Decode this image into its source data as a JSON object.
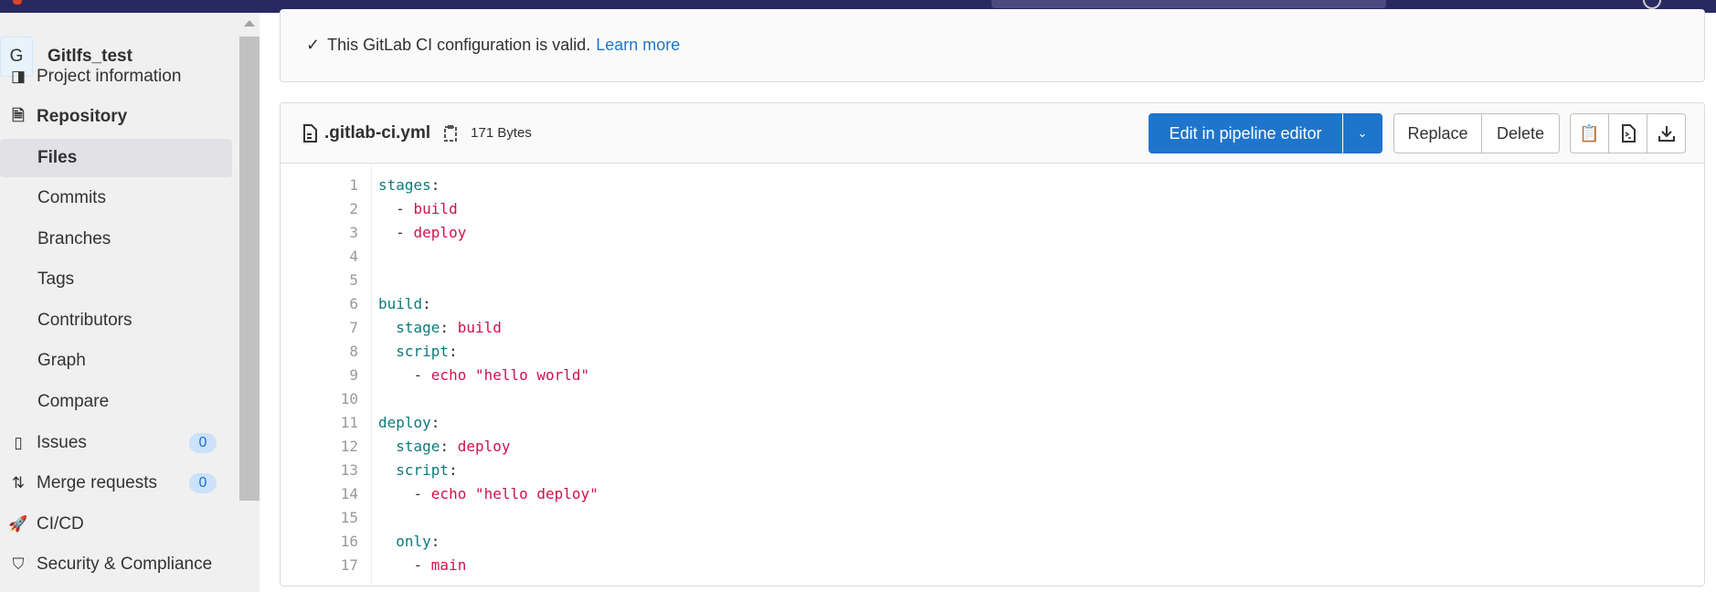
{
  "project": {
    "initial": "G",
    "name": "Gitlfs_test"
  },
  "sidebar": {
    "items": [
      {
        "label": "Project information",
        "icon": "project-info-icon"
      },
      {
        "label": "Repository",
        "icon": "document-icon"
      },
      {
        "label": "Files"
      },
      {
        "label": "Commits"
      },
      {
        "label": "Branches"
      },
      {
        "label": "Tags"
      },
      {
        "label": "Contributors"
      },
      {
        "label": "Graph"
      },
      {
        "label": "Compare"
      },
      {
        "label": "Issues",
        "icon": "issues-icon",
        "badge": "0"
      },
      {
        "label": "Merge requests",
        "icon": "merge-request-icon",
        "badge": "0"
      },
      {
        "label": "CI/CD",
        "icon": "rocket-icon"
      },
      {
        "label": "Security & Compliance",
        "icon": "shield-icon"
      }
    ]
  },
  "alert": {
    "text": "This GitLab CI configuration is valid.",
    "link": "Learn more"
  },
  "file": {
    "name": ".gitlab-ci.yml",
    "size": "171 Bytes",
    "edit_label": "Edit in pipeline editor",
    "replace_label": "Replace",
    "delete_label": "Delete",
    "lines": [
      [
        [
          "k",
          "stages"
        ],
        [
          "p",
          ":"
        ]
      ],
      [
        [
          "p",
          "  - "
        ],
        [
          "v",
          "build"
        ]
      ],
      [
        [
          "p",
          "  - "
        ],
        [
          "v",
          "deploy"
        ]
      ],
      [],
      [],
      [
        [
          "k",
          "build"
        ],
        [
          "p",
          ":"
        ]
      ],
      [
        [
          "p",
          "  "
        ],
        [
          "k",
          "stage"
        ],
        [
          "p",
          ": "
        ],
        [
          "v",
          "build"
        ]
      ],
      [
        [
          "p",
          "  "
        ],
        [
          "k",
          "script"
        ],
        [
          "p",
          ":"
        ]
      ],
      [
        [
          "p",
          "    - "
        ],
        [
          "v",
          "echo \"hello world\""
        ]
      ],
      [],
      [
        [
          "k",
          "deploy"
        ],
        [
          "p",
          ":"
        ]
      ],
      [
        [
          "p",
          "  "
        ],
        [
          "k",
          "stage"
        ],
        [
          "p",
          ": "
        ],
        [
          "v",
          "deploy"
        ]
      ],
      [
        [
          "p",
          "  "
        ],
        [
          "k",
          "script"
        ],
        [
          "p",
          ":"
        ]
      ],
      [
        [
          "p",
          "    - "
        ],
        [
          "v",
          "echo \"hello deploy\""
        ]
      ],
      [],
      [
        [
          "p",
          "  "
        ],
        [
          "k",
          "only"
        ],
        [
          "p",
          ":"
        ]
      ],
      [
        [
          "p",
          "    - "
        ],
        [
          "v",
          "main"
        ]
      ]
    ]
  },
  "colors": {
    "topbar": "#292961",
    "primary": "#1f75cb",
    "yaml_key": "#0c7a7a",
    "yaml_value": "#d1114b"
  }
}
